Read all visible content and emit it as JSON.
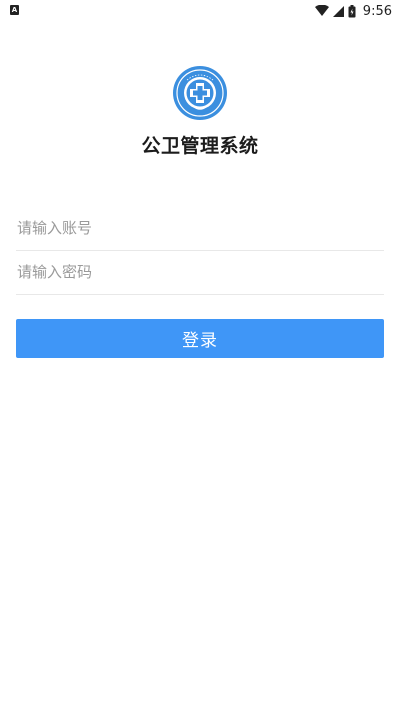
{
  "status_bar": {
    "left_badge": "A",
    "time": "9:56",
    "icons": [
      "wifi-icon",
      "signal-icon",
      "battery-icon"
    ]
  },
  "app": {
    "logo_icon": "health-emblem-icon",
    "title": "公卫管理系统"
  },
  "login_form": {
    "account_placeholder": "请输入账号",
    "account_value": "",
    "password_placeholder": "请输入密码",
    "password_value": "",
    "submit_label": "登录"
  },
  "colors": {
    "primary": "#3f96f7",
    "logo_blue": "#3b8fdf",
    "divider": "#e8e8e8",
    "placeholder": "#9a9a9a"
  }
}
